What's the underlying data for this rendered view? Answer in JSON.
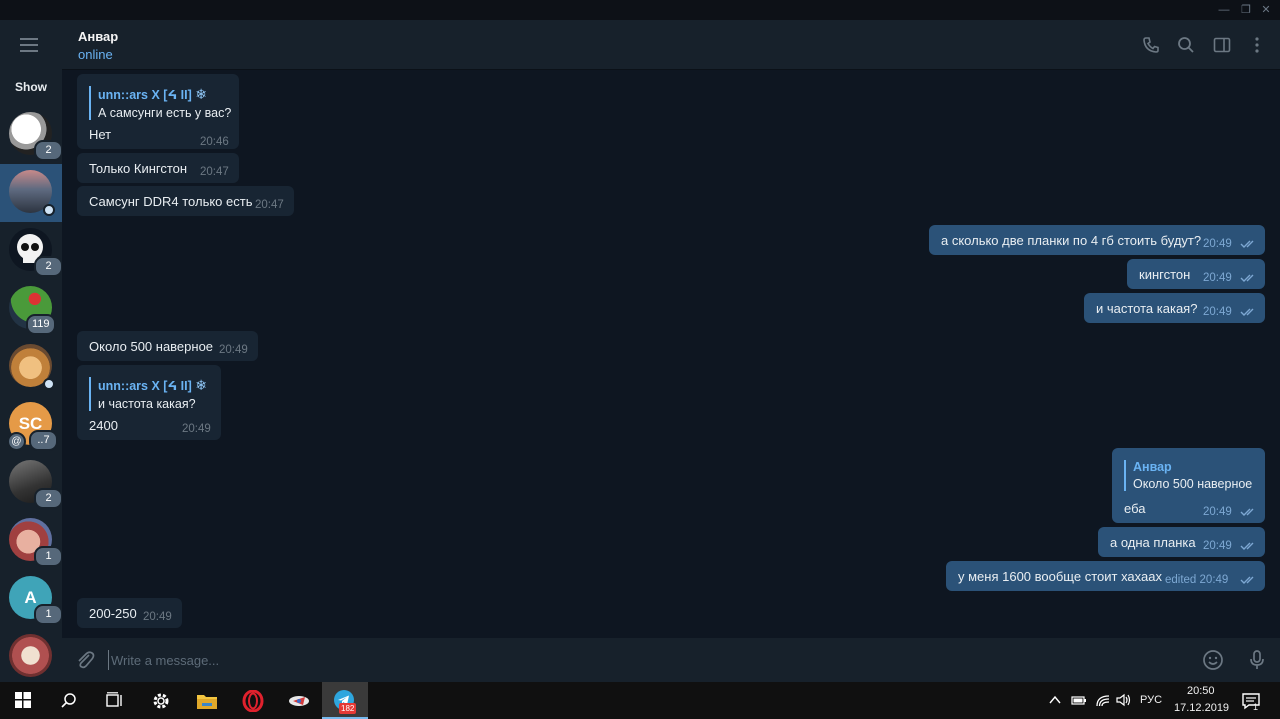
{
  "header": {
    "name": "Анвар",
    "status": "online"
  },
  "sidebar": {
    "show_label": "Show",
    "chats": [
      {
        "badge": "2",
        "avatar_color": "#d9d9d9"
      },
      {
        "badge": "",
        "avatar_color": "#7a6a72",
        "active": true,
        "online": true
      },
      {
        "badge": "2",
        "avatar_color": "#111111"
      },
      {
        "badge": "119",
        "avatar_color": "#3c8c3c"
      },
      {
        "badge": "",
        "avatar_color": "#e0b07a",
        "online": true
      },
      {
        "badge": "..7",
        "avatar_text": "SC",
        "avatar_color": "#e59a47",
        "mention": "@"
      },
      {
        "badge": "2",
        "avatar_color": "#5a5a5a"
      },
      {
        "badge": "1",
        "avatar_color": "#c0706a"
      },
      {
        "badge": "1",
        "avatar_text": "A",
        "avatar_color": "#3fa4b8"
      },
      {
        "badge": "",
        "avatar_color": "#a05050"
      }
    ]
  },
  "messages": [
    {
      "dir": "in",
      "reply_name": "unn::ars X [ᔦ II]",
      "reply_text": "А самсунги есть у вас?",
      "text": "Нет",
      "time": "20:46"
    },
    {
      "dir": "in",
      "text": "Только Кингстон",
      "time": "20:47"
    },
    {
      "dir": "in",
      "text": "Самсунг DDR4 только есть",
      "time": "20:47"
    },
    {
      "dir": "out",
      "text": "а сколько две планки по 4 гб стоить будут?",
      "time": "20:49"
    },
    {
      "dir": "out",
      "text": "кингстон",
      "time": "20:49"
    },
    {
      "dir": "out",
      "text": "и частота какая?",
      "time": "20:49"
    },
    {
      "dir": "in",
      "text": "Около 500 наверное",
      "time": "20:49"
    },
    {
      "dir": "in",
      "reply_name": "unn::ars X [ᔦ II]",
      "reply_text": "и частота какая?",
      "text": "2400",
      "time": "20:49"
    },
    {
      "dir": "out",
      "reply_name": "Анвар",
      "reply_text": "Около 500 наверное",
      "text": "еба",
      "time": "20:49"
    },
    {
      "dir": "out",
      "text": "а одна планка",
      "time": "20:49"
    },
    {
      "dir": "out",
      "text": "у меня 1600 вообще стоит хахаах",
      "time": "edited 20:49"
    },
    {
      "dir": "in",
      "text": "200-250",
      "time": "20:49"
    }
  ],
  "composer": {
    "placeholder": "Write a message..."
  },
  "taskbar": {
    "telegram_badge": "182",
    "language": "РУС",
    "clock_time": "20:50",
    "clock_date": "17.12.2019",
    "notifications": "1"
  },
  "icons": {
    "snowflake": "❄"
  },
  "colors": {
    "bg": "#0e1621",
    "panel": "#17212b",
    "incoming": "#182533",
    "outgoing": "#2b5278",
    "accent": "#6ab3f3"
  }
}
